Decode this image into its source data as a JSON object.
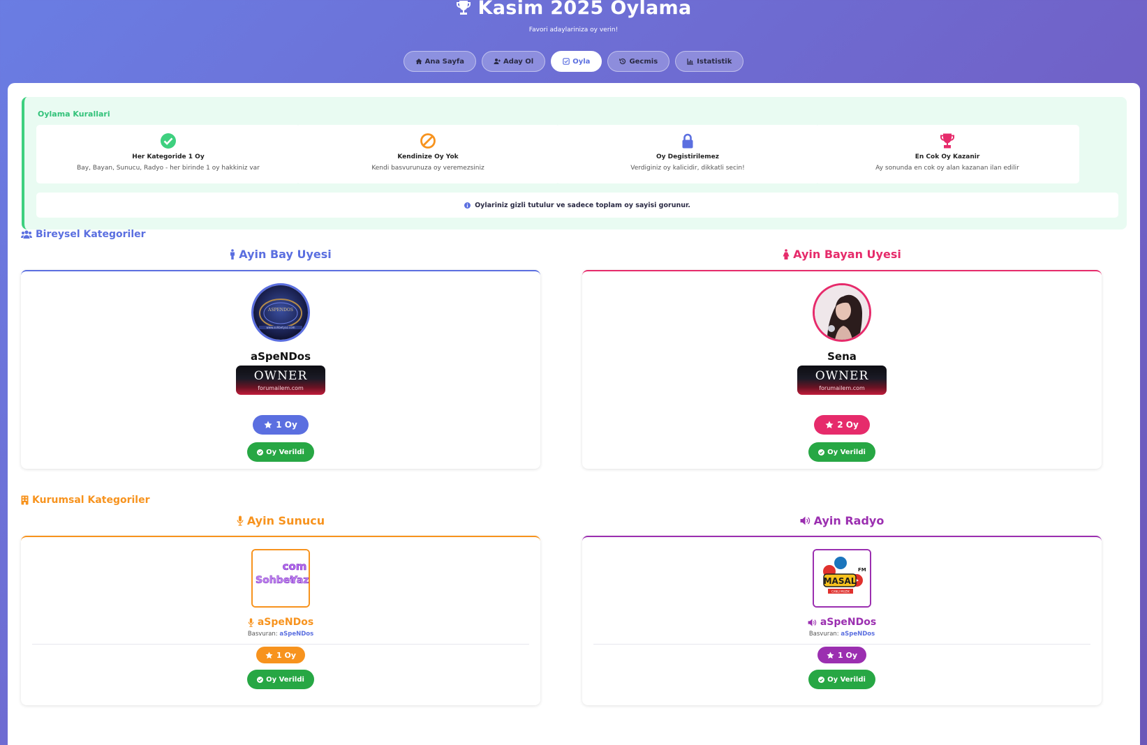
{
  "header": {
    "title": "Kasim 2025 Oylama",
    "subtitle": "Favori adaylariniza oy verin!"
  },
  "nav": [
    {
      "label": "Ana Sayfa",
      "icon": "home-icon",
      "active": false
    },
    {
      "label": "Aday Ol",
      "icon": "user-plus-icon",
      "active": false
    },
    {
      "label": "Oyla",
      "icon": "check-square-icon",
      "active": true
    },
    {
      "label": "Gecmis",
      "icon": "history-icon",
      "active": false
    },
    {
      "label": "Istatistik",
      "icon": "chart-icon",
      "active": false
    }
  ],
  "rules": {
    "title": "Oylama Kurallari",
    "items": [
      {
        "title": "Her Kategoride 1 Oy",
        "desc": "Bay, Bayan, Sunucu, Radyo - her birinde 1 oy hakkiniz var",
        "icon": "check-circle-icon",
        "color": "#3ed07f"
      },
      {
        "title": "Kendinize Oy Yok",
        "desc": "Kendi basvurunuza oy veremezsiniz",
        "icon": "ban-icon",
        "color": "#f7931e"
      },
      {
        "title": "Oy Degistirilemez",
        "desc": "Verdiginiz oy kalicidir, dikkatli secin!",
        "icon": "lock-icon",
        "color": "#5b6fe0"
      },
      {
        "title": "En Cok Oy Kazanir",
        "desc": "Ay sonunda en cok oy alan kazanan ilan edilir",
        "icon": "trophy-icon",
        "color": "#e62b6b"
      }
    ],
    "note": "Oylariniz gizli tutulur ve sadece toplam oy sayisi gorunur."
  },
  "individual": {
    "section_title": "Bireysel Kategoriler",
    "section_color": "#5b6fe0",
    "categories": [
      {
        "title": "Ayin Bay Uyesi",
        "color": "#5b6fe0",
        "icon": "male-icon",
        "username": "aSpeNDos",
        "rank_text": "OWNER",
        "rank_site": "forumailem.com",
        "votes": "1 Oy",
        "voted": "Oy Verildi"
      },
      {
        "title": "Ayin Bayan Uyesi",
        "color": "#e62b6b",
        "icon": "female-icon",
        "username": "Sena",
        "rank_text": "OWNER",
        "rank_site": "forumailem.com",
        "votes": "2 Oy",
        "voted": "Oy Verildi"
      }
    ]
  },
  "institutional": {
    "section_title": "Kurumsal Kategoriler",
    "section_color": "#f7931e",
    "categories": [
      {
        "title": "Ayin Sunucu",
        "color": "#f7931e",
        "icon": "microphone-icon",
        "name": "aSpeNDos",
        "applicant_label": "Basvuran:",
        "applicant": "aSpeNDos",
        "logo_text_1": "Sohbet",
        "logo_text_2": "Yaz",
        "logo_text_3": "com",
        "votes": "1 Oy",
        "voted": "Oy Verildi"
      },
      {
        "title": "Ayin Radyo",
        "color": "#9b2fb0",
        "icon": "volume-icon",
        "name": "aSpeNDos",
        "applicant_label": "Basvuran:",
        "applicant": "aSpeNDos",
        "logo_text_1": "MASAL",
        "logo_text_2": "FM",
        "logo_text_3": "CANLI MUZIK",
        "votes": "1 Oy",
        "voted": "Oy Verildi"
      }
    ]
  }
}
